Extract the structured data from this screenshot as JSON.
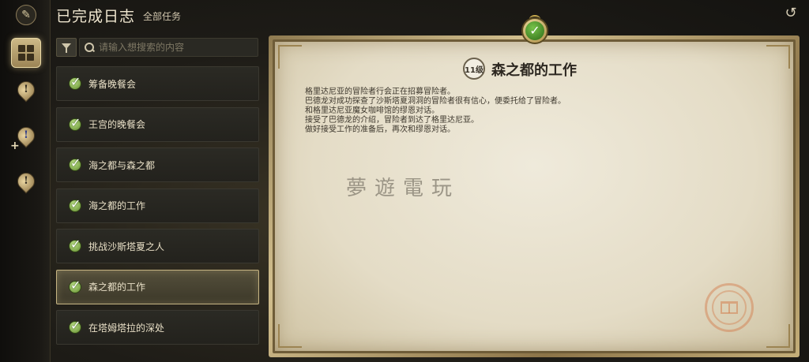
{
  "header": {
    "title": "已完成日志",
    "subtitle": "全部任务"
  },
  "search": {
    "placeholder": "请输入想搜索的内容",
    "value": ""
  },
  "quests": [
    {
      "label": "筹备晚餐会",
      "selected": false
    },
    {
      "label": "王宫的晚餐会",
      "selected": false
    },
    {
      "label": "海之都与森之都",
      "selected": false
    },
    {
      "label": "海之都的工作",
      "selected": false
    },
    {
      "label": "挑战沙斯塔夏之人",
      "selected": false
    },
    {
      "label": "森之都的工作",
      "selected": true
    },
    {
      "label": "在塔姆塔拉的深处",
      "selected": false
    }
  ],
  "detail": {
    "level_badge": "11级",
    "title": "森之都的工作",
    "description": [
      "格里达尼亚的冒险者行会正在招募冒险者。",
      "巴德龙对成功探查了沙斯塔夏洞洞的冒险者很有信心，便委托给了冒险者。",
      "和格里达尼亚魔女咖啡馆的缪恩对话。",
      "接受了巴德龙的介绍，冒险者到达了格里达尼亚。",
      "做好接受工作的准备后，再次和缪恩对话。"
    ]
  },
  "watermark": "夢遊電玩",
  "icons": {
    "back": "back-arrow-icon",
    "filter": "filter-icon",
    "search": "search-icon",
    "check": "completed-check-icon"
  },
  "colors": {
    "accent_gold": "#c7b583",
    "check_green": "#5f8a2c",
    "parchment": "#efeadb"
  }
}
